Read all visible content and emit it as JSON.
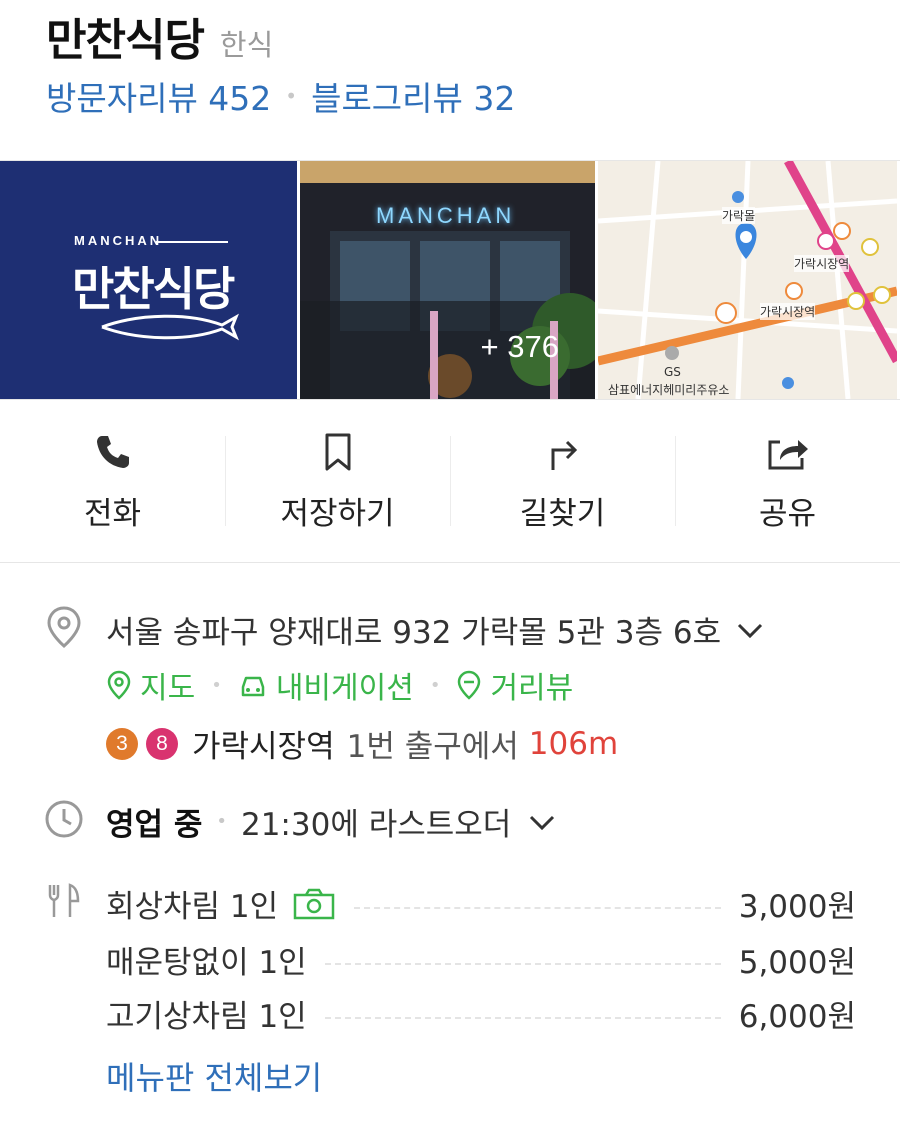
{
  "place": {
    "name": "만찬식당",
    "category": "한식"
  },
  "reviews": {
    "visitor": "방문자리뷰 452",
    "blog": "블로그리뷰 32",
    "separator": "•"
  },
  "photos": {
    "logo_small": "MANCHAN",
    "logo_big": "만찬식당",
    "interior_sign": "MANCHAN",
    "more_count": "+ 376",
    "map_labels": {
      "mall": "가락몰",
      "station1": "가락시장역",
      "station2": "가락시장역",
      "gs": "GS",
      "gas": "삼표에너지헤미리주유소"
    }
  },
  "actions": [
    {
      "label": "전화",
      "icon": "phone-icon"
    },
    {
      "label": "저장하기",
      "icon": "bookmark-icon"
    },
    {
      "label": "길찾기",
      "icon": "directions-icon"
    },
    {
      "label": "공유",
      "icon": "share-icon"
    }
  ],
  "address": {
    "text": "서울 송파구 양재대로 932 가락몰 5관 3층 6호",
    "links": [
      "지도",
      "내비게이션",
      "거리뷰"
    ]
  },
  "subway": {
    "lines": [
      {
        "number": "3",
        "color": "#e07a2c"
      },
      {
        "number": "8",
        "color": "#d9336f"
      }
    ],
    "station": "가락시장역",
    "exit": "1번 출구에서",
    "distance": "106m"
  },
  "hours": {
    "status": "영업 중",
    "detail": "21:30에 라스트오더"
  },
  "menu": {
    "items": [
      {
        "name": "회상차림 1인",
        "price": "3,000원",
        "has_photo": true
      },
      {
        "name": "매운탕없이 1인",
        "price": "5,000원",
        "has_photo": false
      },
      {
        "name": "고기상차림 1인",
        "price": "6,000원",
        "has_photo": false
      }
    ],
    "view_all": "메뉴판 전체보기"
  },
  "colors": {
    "link_blue": "#2f6fb9",
    "link_green": "#3ab54a",
    "distance_red": "#e0433b",
    "logo_navy": "#1e2f73"
  }
}
